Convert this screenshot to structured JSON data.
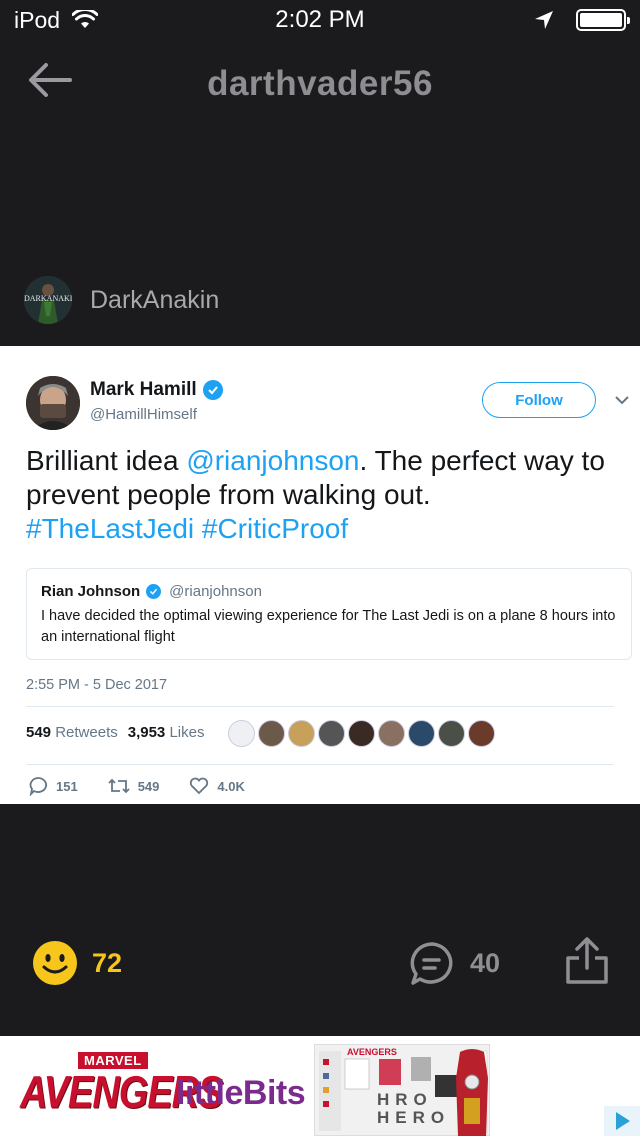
{
  "status_bar": {
    "carrier": "iPod",
    "time": "2:02 PM"
  },
  "header": {
    "title": "darthvader56"
  },
  "author": {
    "name": "DarkAnakin",
    "avatar_text": "DARKANAKIN"
  },
  "tweet": {
    "name": "Mark Hamill",
    "handle": "@HamillHimself",
    "follow_label": "Follow",
    "text_part1": "Brilliant idea ",
    "mention": "@rianjohnson",
    "text_part2": ". The perfect way to prevent people from walking out.",
    "hashtags": "#TheLastJedi #CriticProof",
    "quote": {
      "name": "Rian Johnson",
      "handle": "@rianjohnson",
      "text": "I have decided the optimal viewing experience for The Last Jedi is on a plane 8 hours into an international flight"
    },
    "timestamp": "2:55 PM - 5 Dec 2017",
    "retweets_count": "549",
    "retweets_label": "Retweets",
    "likes_count": "3,953",
    "likes_label": "Likes",
    "replies": "151",
    "retweets_action": "549",
    "likes_action": "4.0K",
    "link_color": "#1da1f2"
  },
  "bottom_bar": {
    "smile_count": "72",
    "comment_count": "40",
    "smile_color": "#f7c61c"
  },
  "ad": {
    "marvel": "MARVEL",
    "avengers": "AVENGERS",
    "littlebits": "littleBits",
    "box_title": "AVENGERS",
    "hero_text": "HRO HERO"
  }
}
